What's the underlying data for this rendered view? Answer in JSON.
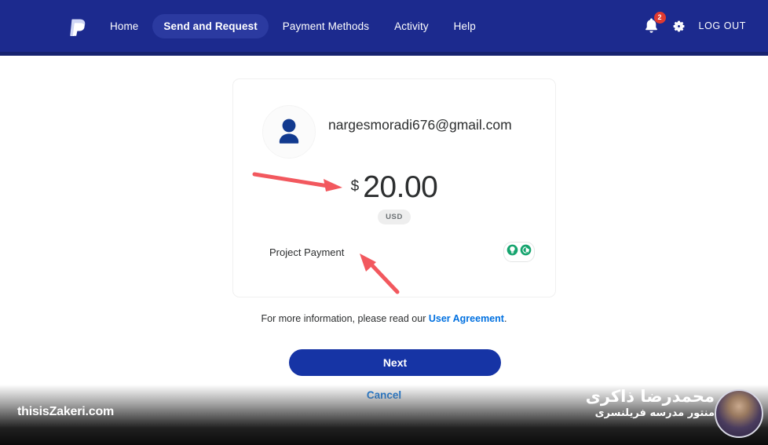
{
  "header": {
    "logo": "paypal-logo",
    "nav": [
      {
        "label": "Home",
        "active": false
      },
      {
        "label": "Send and Request",
        "active": true
      },
      {
        "label": "Payment Methods",
        "active": false
      },
      {
        "label": "Activity",
        "active": false
      },
      {
        "label": "Help",
        "active": false
      }
    ],
    "notification_count": "2",
    "bell_icon": "bell-icon",
    "gear_icon": "gear-icon",
    "logout_label": "LOG OUT",
    "background_color": "#1c2a8e"
  },
  "card": {
    "avatar_icon": "person-avatar-icon",
    "recipient_email": "nargesmoradi676@gmail.com",
    "currency_symbol": "$",
    "amount": "20.00",
    "currency_code": "USD",
    "note": "Project Payment",
    "grammarly_icons": [
      "grammarly-bulb-icon",
      "grammarly-g-icon"
    ]
  },
  "footer": {
    "info_prefix": "For more information, please read our ",
    "info_link": "User Agreement",
    "info_suffix": ".",
    "next_label": "Next",
    "cancel_label": "Cancel",
    "next_color": "#1634a5",
    "link_color": "#0070e0"
  },
  "watermark": {
    "site": "thisisZakeri.com",
    "name": "محمدرضا ذاکری",
    "subtitle": "منتور مدرسه فریلنسری"
  }
}
